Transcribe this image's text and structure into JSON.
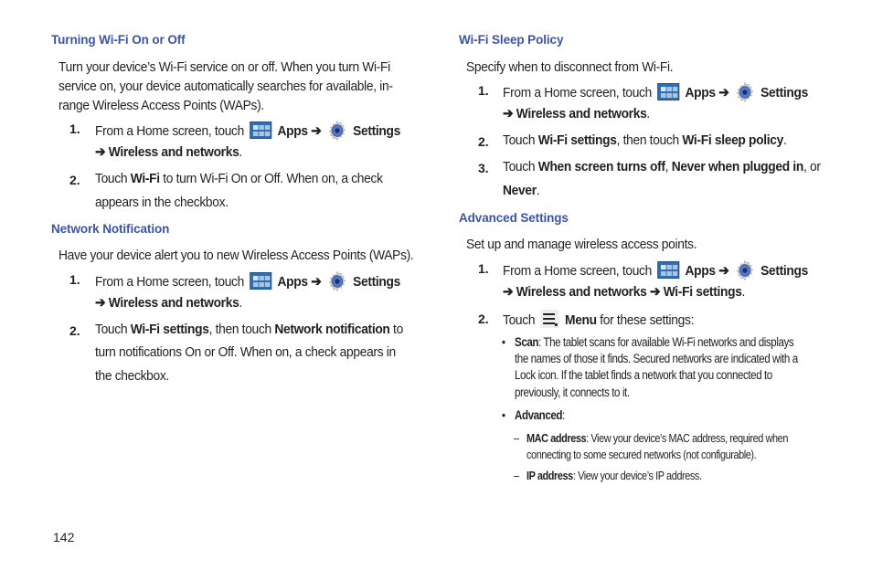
{
  "page_number": "142",
  "left": {
    "sections": [
      {
        "heading": "Turning Wi-Fi On or Off",
        "intro_lines": [
          "Turn your device’s Wi-Fi service on or off. When you turn Wi-Fi",
          "service on, your device automatically searches for available, in-",
          "range Wireless Access Points (WAPs)."
        ],
        "steps": [
          {
            "num": "1.",
            "line1": {
              "pre": "From a Home screen, touch",
              "apps": "Apps",
              "arrow": "➔",
              "settings": "Settings"
            },
            "line2": {
              "arrow": "➔",
              "bold": "Wireless and networks",
              "post": "."
            }
          },
          {
            "num": "2.",
            "line1": {
              "pre": "Touch ",
              "bold": "Wi-Fi",
              "post": " to turn Wi-Fi On or Off. When on, a check"
            },
            "line2": "appears in the checkbox."
          }
        ]
      },
      {
        "heading": "Network Notification",
        "intro_lines": [
          "Have your device alert you to new Wireless Access Points (WAPs)."
        ],
        "steps": [
          {
            "num": "1.",
            "line1": {
              "pre": "From a Home screen, touch",
              "apps": "Apps",
              "arrow": "➔",
              "settings": "Settings"
            },
            "line2": {
              "arrow": "➔",
              "bold": "Wireless and networks",
              "post": "."
            }
          },
          {
            "num": "2.",
            "line1": {
              "pre": "Touch ",
              "bold1": "Wi-Fi settings",
              "mid": ", then touch ",
              "bold2": "Network notification",
              "post": " to"
            },
            "line2": "turn notifications On or Off. When on, a check appears in",
            "line3": "the checkbox."
          }
        ]
      }
    ]
  },
  "right": {
    "sections": [
      {
        "heading": "Wi-Fi Sleep Policy",
        "intro": "Specify when to disconnect from Wi-Fi.",
        "steps": [
          {
            "num": "1.",
            "line1": {
              "pre": "From a Home screen, touch",
              "apps": "Apps",
              "arrow": "➔",
              "settings": "Settings"
            },
            "line2": {
              "arrow": "➔",
              "bold": "Wireless and networks",
              "post": "."
            }
          },
          {
            "num": "2.",
            "line1": {
              "pre": "Touch ",
              "bold1": "Wi-Fi settings",
              "mid": ", then touch ",
              "bold2": "Wi-Fi sleep policy",
              "post": "."
            }
          },
          {
            "num": "3.",
            "line1": {
              "pre": "Touch ",
              "bold1": "When screen turns off",
              "mid": ", ",
              "bold2": "Never when plugged in",
              "post": ", or"
            },
            "line2": {
              "bold": "Never",
              "post": "."
            }
          }
        ]
      },
      {
        "heading": "Advanced Settings",
        "intro": "Set up and manage wireless access points.",
        "steps": [
          {
            "num": "1.",
            "line1": {
              "pre": "From a Home screen, touch",
              "apps": "Apps",
              "arrow": "➔",
              "settings": "Settings"
            },
            "line2": {
              "arrow": "➔",
              "bold1": "Wireless and networks",
              "arrow2": "➔",
              "bold2": "Wi-Fi settings",
              "post": "."
            }
          },
          {
            "num": "2.",
            "line1": {
              "pre": "Touch",
              "bold": "Menu",
              "post": " for these settings:"
            }
          }
        ],
        "bullets": [
          {
            "marker": "•",
            "bold": "Scan",
            "lines": [
              ": The tablet scans for available Wi-Fi networks and displays",
              "the names of those it finds. Secured networks are indicated with a",
              "Lock icon. If the tablet finds a network that you connected to",
              "previously, it connects to it."
            ]
          },
          {
            "marker": "•",
            "bold": "Advanced",
            "lines": [
              ":"
            ],
            "sub": [
              {
                "marker": "–",
                "bold": "MAC address",
                "lines": [
                  ": View your device’s MAC address, required when",
                  "connecting to some secured networks (not configurable)."
                ]
              },
              {
                "marker": "–",
                "bold": "IP address",
                "lines": [
                  ": View your device’s IP address."
                ]
              }
            ]
          }
        ]
      }
    ]
  },
  "colors": {
    "heading": "#3b55a6",
    "text": "#231f20",
    "apps_icon": "#2d6fb5",
    "gear_icon": "#4a6fc4"
  }
}
